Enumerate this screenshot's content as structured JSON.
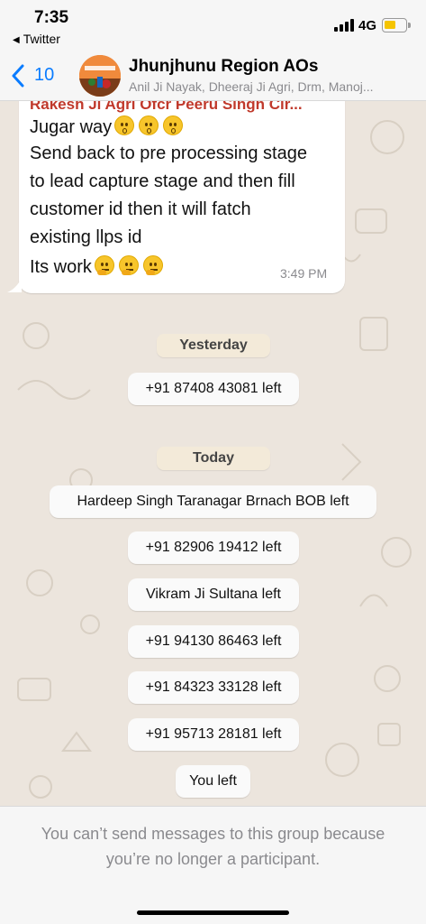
{
  "status_bar": {
    "time": "7:35",
    "back_app": "Twitter",
    "network": "4G",
    "battery_color": "#f5c400"
  },
  "header": {
    "back_count": "10",
    "title": "Jhunjhunu Region AOs",
    "subtitle": "Anil Ji Nayak, Dheeraj Ji Agri, Drm, Manoj...",
    "accent_color": "#0a7cff"
  },
  "message": {
    "sender": "Rakesh Ji Agri Ofcr Peeru Singh Cir...",
    "sender_color": "#c0392b",
    "lines": [
      "Jugar way",
      "Send back to pre processing stage",
      "to lead capture stage and then fill",
      "customer id then it will fatch",
      "existing llps id",
      "Its work"
    ],
    "emoji_line1": [
      "hushed-face-emoji",
      "hushed-face-emoji",
      "hushed-face-emoji"
    ],
    "emoji_line6": [
      "thinking-face-emoji",
      "thinking-face-emoji",
      "thinking-face-emoji"
    ],
    "time": "3:49 PM"
  },
  "chat": {
    "yesterday_label": "Yesterday",
    "yesterday_events": [
      "+91 87408 43081 left"
    ],
    "today_label": "Today",
    "today_events": [
      "Hardeep Singh Taranagar Brnach BOB left",
      "+91 82906 19412 left",
      "Vikram Ji Sultana left",
      "+91 94130 86463 left",
      "+91 84323 33128 left",
      "+91 95713 28181 left",
      "You left"
    ]
  },
  "footer": {
    "notice_line1": "You can’t send messages to this group because",
    "notice_line2": "you’re no longer a participant."
  }
}
